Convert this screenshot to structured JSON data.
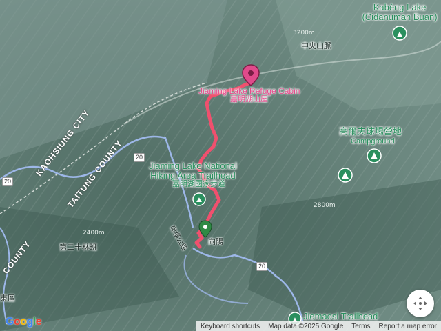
{
  "map": {
    "colors": {
      "route": "#f0506e",
      "poi_pink": "#e64a8c",
      "poi_green": "#2a8f5e",
      "road": "#9db7e8"
    },
    "labels": {
      "kabeng_lake": "Kabèng Lake\n(Cidanuman Buan)",
      "refuge_en": "Jiaming Lake Refuge Cabin",
      "refuge_zh": "嘉明湖山屋",
      "campground_zh": "高爾夫球場營地",
      "campground_en": "Campground",
      "trailhead_en": "Jiaming Lake National\nHiking Area Trailhead",
      "trailhead_zh": "嘉明湖國家步道",
      "central_range": "中央山脈",
      "kaohsiung": "KAOHSIUNG CITY",
      "taitung": "TAITUNG COUNTY",
      "county_edge": "COUNTY",
      "forest_20": "第二十林班",
      "xiangyang": "向陽",
      "nanheng": "南橫公路",
      "jiemaosi": "Jiemaosi Trailhead",
      "edge_left": "東區"
    },
    "shields": [
      "20",
      "20",
      "20"
    ],
    "contours": [
      "3200m",
      "2800m",
      "2400m"
    ]
  },
  "footer": {
    "keyboard": "Keyboard shortcuts",
    "mapdata": "Map data ©2025 Google",
    "terms": "Terms",
    "report": "Report a map error"
  },
  "google": {
    "logo": "Google"
  },
  "icons": {
    "locate": "locate-icon",
    "pin": "map-pin-icon",
    "trailhead": "trailhead-marker-icon",
    "campground": "campground-icon",
    "park": "park-icon"
  }
}
